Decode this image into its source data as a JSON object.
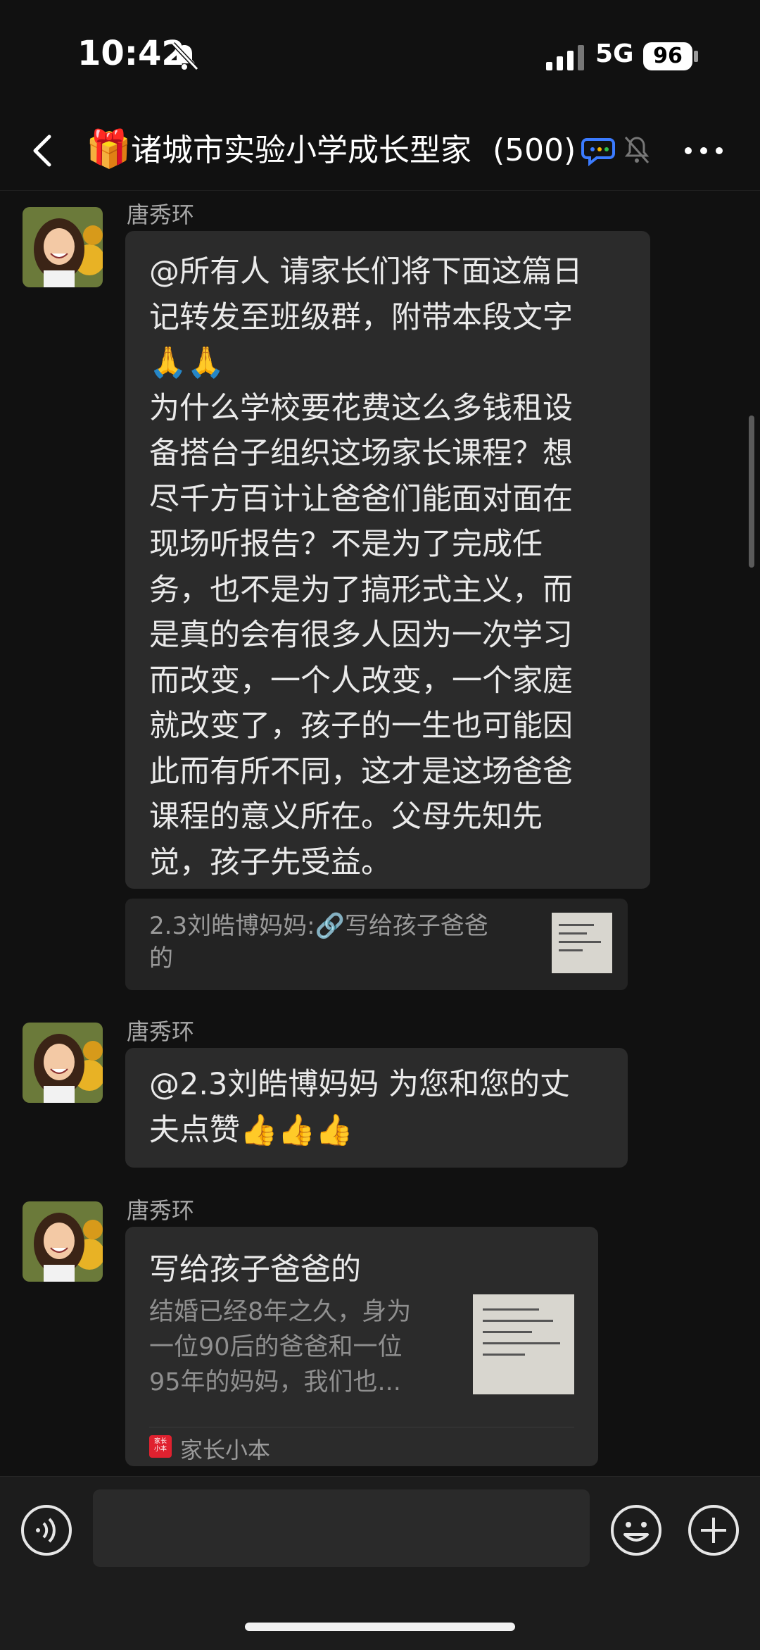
{
  "status_bar": {
    "time": "10:42",
    "network": "5G",
    "battery": "96"
  },
  "header": {
    "emoji": "🎁",
    "title": "诸城市实验小学成长型家",
    "member_count": "(500)"
  },
  "messages": [
    {
      "sender": "唐秀环",
      "text": "@所有人 请家长们将下面这篇日\n记转发至班级群，附带本段文字\n🙏🙏\n为什么学校要花费这么多钱租设\n备搭台子组织这场家长课程？想\n尽千方百计让爸爸们能面对面在\n现场听报告？不是为了完成任\n务，也不是为了搞形式主义，而\n是真的会有很多人因为一次学习\n而改变，一个人改变，一个家庭\n就改变了，孩子的一生也可能因\n此而有所不同，这才是这场爸爸\n课程的意义所在。父母先知先\n觉，孩子先受益。",
      "quote": {
        "author": "2.3刘皓博妈妈:",
        "link_text": "写给孩子爸爸\n的"
      }
    },
    {
      "sender": "唐秀环",
      "text": "@2.3刘皓博妈妈 为您和您的丈\n夫点赞👍👍👍"
    },
    {
      "sender": "唐秀环",
      "card": {
        "title": "写给孩子爸爸的",
        "desc": "结婚已经8年之久，身为\n一位90后的爸爸和一位\n95年的妈妈，我们也...",
        "source_badge": "家长\n小本",
        "source": "家长小本"
      }
    }
  ],
  "input": {
    "placeholder": ""
  }
}
